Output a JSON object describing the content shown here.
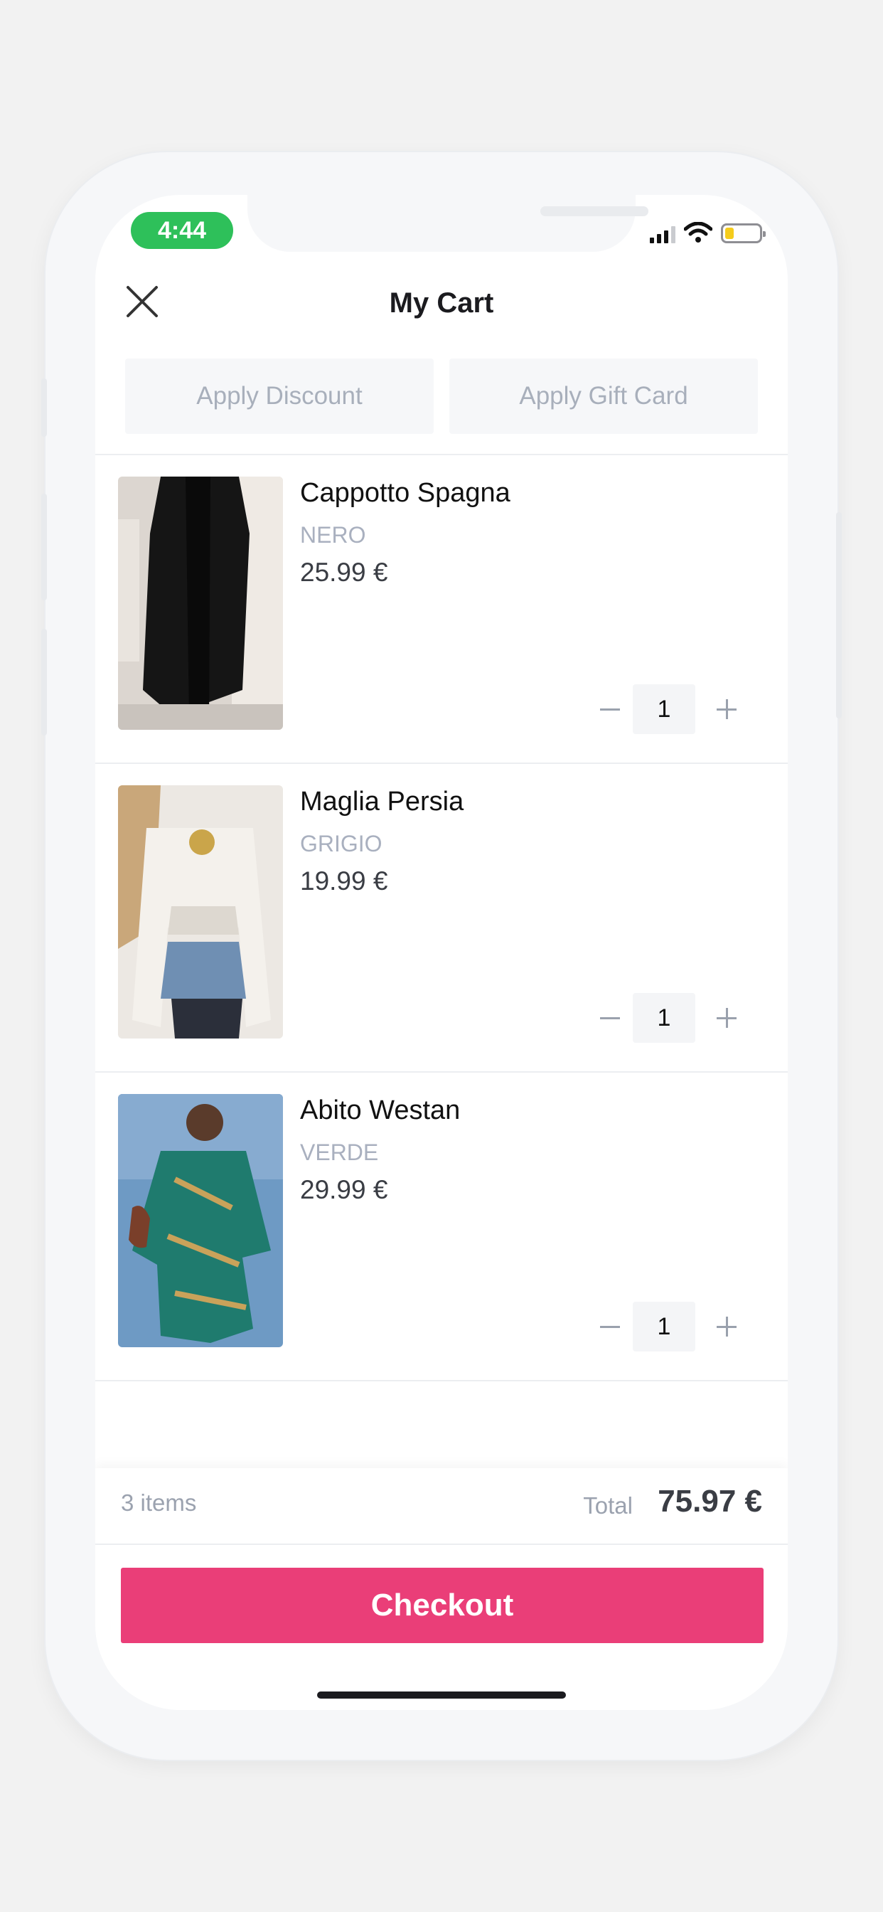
{
  "status_bar": {
    "time": "4:44",
    "signal_icon": "signal-icon",
    "wifi_icon": "wifi-icon",
    "battery_icon": "battery-icon"
  },
  "header": {
    "title": "My Cart",
    "close_icon": "close-icon"
  },
  "actions": {
    "discount_label": "Apply Discount",
    "giftcard_label": "Apply Gift Card"
  },
  "items": [
    {
      "name": "Cappotto Spagna",
      "color": "NERO",
      "price": "25.99 €",
      "qty": "1"
    },
    {
      "name": "Maglia Persia",
      "color": "GRIGIO",
      "price": "19.99 €",
      "qty": "1"
    },
    {
      "name": "Abito Westan",
      "color": "VERDE",
      "price": "29.99 €",
      "qty": "1"
    }
  ],
  "summary": {
    "count": "3 items",
    "total_label": "Total",
    "total": "75.97 €"
  },
  "checkout": {
    "label": "Checkout"
  },
  "colors": {
    "accent": "#ea3e78",
    "status_green": "#2ec05a"
  }
}
